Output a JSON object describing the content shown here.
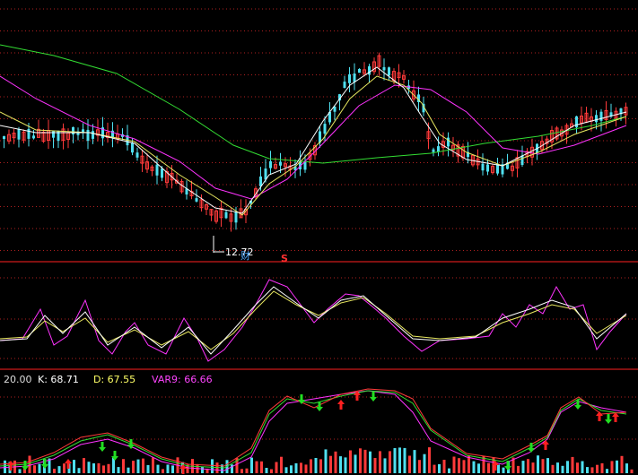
{
  "colors": {
    "background": "#000000",
    "bull": "#ff3a3a",
    "bear": "#4fe0f0",
    "ma_white": "#ffffff",
    "ma_yellow": "#e8e860",
    "ma_magenta": "#ff33ff",
    "ma_green": "#33dd33",
    "divider": "#ff2020",
    "grid": "#b02020",
    "arrow_up": "#ff2020",
    "arrow_down": "#22dd22"
  },
  "price_panel": {
    "low_marker": "12.72",
    "finance_badge": "财",
    "s_badge": "S"
  },
  "indicator_panel": {
    "header": {
      "period": "20.00",
      "k_label": "K: 68.71",
      "d_label": "D: 67.55",
      "var_label": "VAR9: 66.66"
    }
  }
}
